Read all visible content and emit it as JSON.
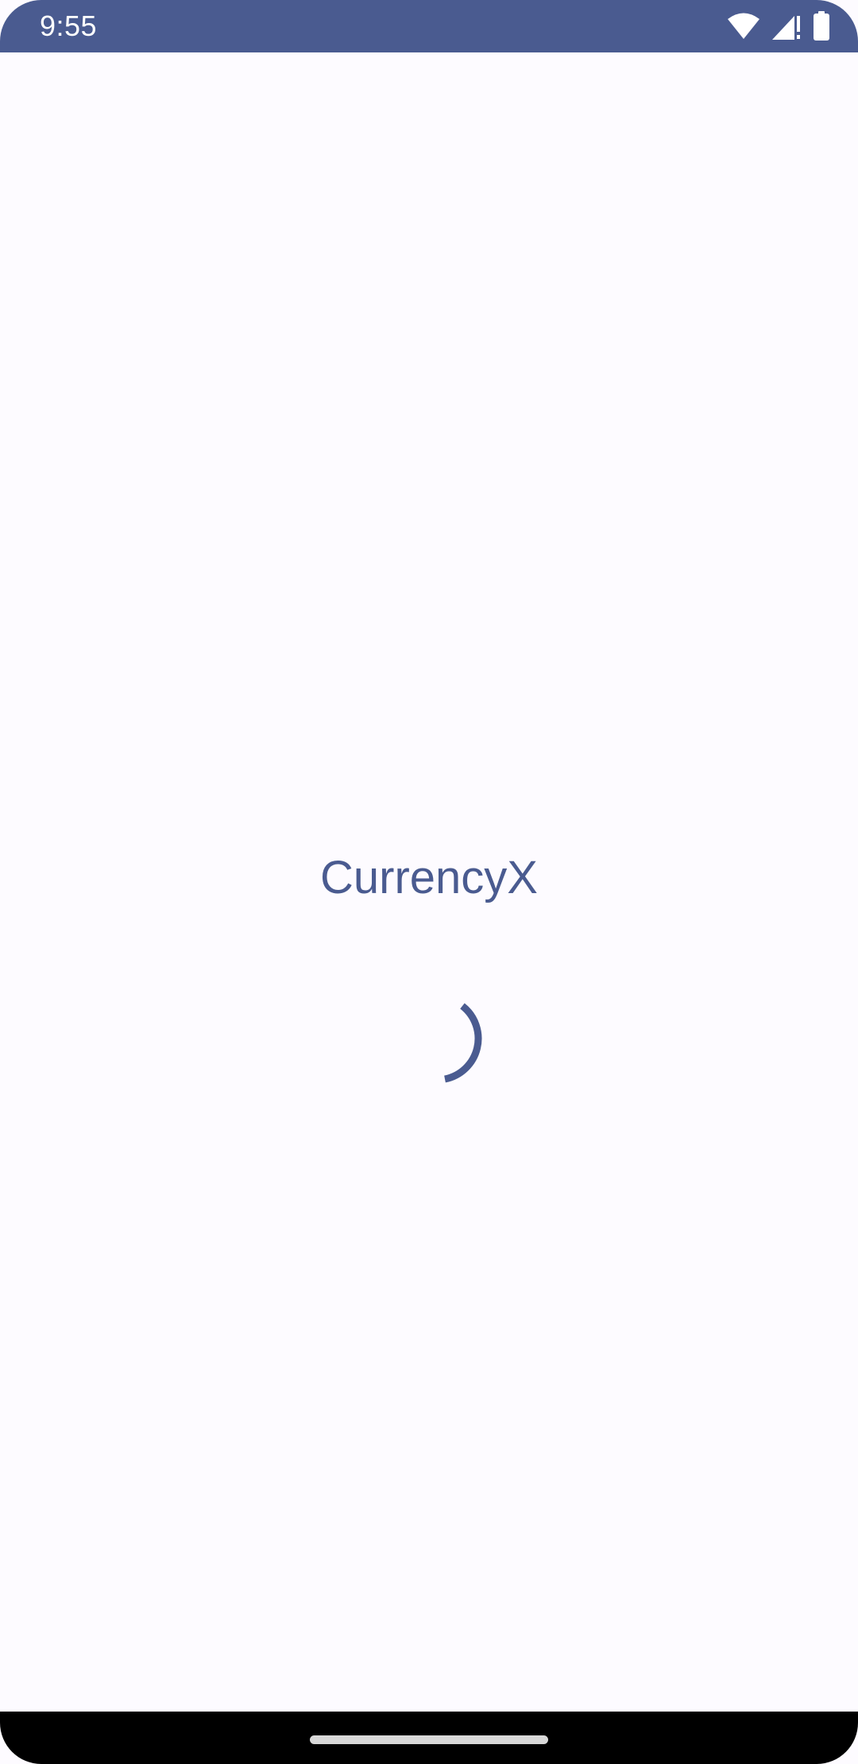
{
  "status_bar": {
    "time": "9:55",
    "background_color": "#4a5b90",
    "icons": [
      "wifi-icon",
      "signal-alert-icon",
      "battery-icon"
    ]
  },
  "main": {
    "app_title": "CurrencyX",
    "accent_color": "#4a5b90",
    "background_color": "#fdfbff",
    "loading_indicator": "progress-spinner-icon"
  },
  "nav_bar": {
    "gesture_handle": "home-gesture-handle"
  }
}
